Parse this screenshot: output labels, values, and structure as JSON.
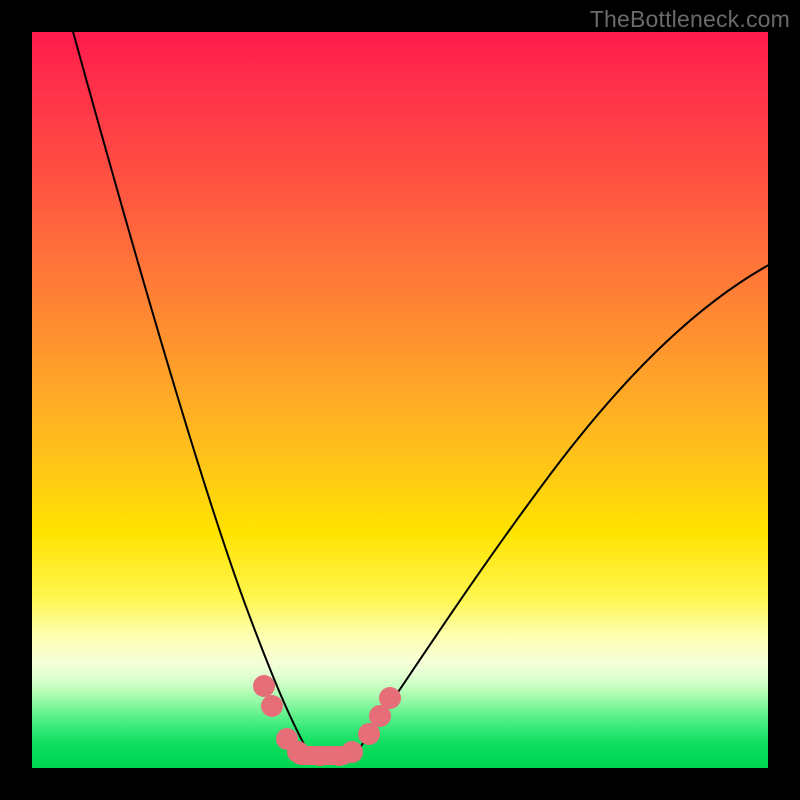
{
  "watermark": "TheBottleneck.com",
  "colors": {
    "frame": "#000000",
    "watermark": "#6a6a6a",
    "curve": "#000000",
    "bead": "#e56e79",
    "gradient_stops": [
      "#ff1a4b",
      "#ff2f4a",
      "#ff5740",
      "#ff7e36",
      "#ffa229",
      "#ffc31a",
      "#ffe300",
      "#fff650",
      "#feffb0",
      "#f6ffd6",
      "#e8ffd6",
      "#c6ffc0",
      "#92f9a4",
      "#5bf08a",
      "#2de773",
      "#0adc5d",
      "#00d552"
    ]
  },
  "chart_data": {
    "type": "line",
    "title": "",
    "xlabel": "",
    "ylabel": "",
    "xlim": [
      0,
      100
    ],
    "ylim": [
      0,
      100
    ],
    "grid": false,
    "series": [
      {
        "name": "left-curve",
        "x": [
          5,
          8,
          11,
          14,
          17,
          20,
          23,
          26,
          29,
          31,
          33,
          35.5,
          37.5
        ],
        "y": [
          100,
          86,
          73,
          61,
          50,
          40,
          31,
          23,
          16,
          11,
          7,
          3,
          1
        ]
      },
      {
        "name": "right-curve",
        "x": [
          44,
          47,
          51,
          56,
          61,
          67,
          73,
          80,
          87,
          94,
          100
        ],
        "y": [
          1,
          4,
          9,
          15,
          22,
          29,
          37,
          45,
          53,
          61,
          68
        ]
      }
    ],
    "markers": {
      "name": "beads",
      "points": [
        {
          "x": 31.5,
          "y": 10.5
        },
        {
          "x": 32.5,
          "y": 8
        },
        {
          "x": 34.5,
          "y": 3
        },
        {
          "x": 36.5,
          "y": 1.5
        },
        {
          "x": 39,
          "y": 1
        },
        {
          "x": 41.5,
          "y": 1
        },
        {
          "x": 43.5,
          "y": 1.5
        },
        {
          "x": 46,
          "y": 4
        },
        {
          "x": 47.5,
          "y": 6.5
        },
        {
          "x": 48.5,
          "y": 9
        }
      ]
    },
    "background_scale": {
      "orientation": "vertical",
      "top_value": 100,
      "bottom_value": 0,
      "meaning": "bottleneck percentage (red=high, green=low)"
    }
  }
}
